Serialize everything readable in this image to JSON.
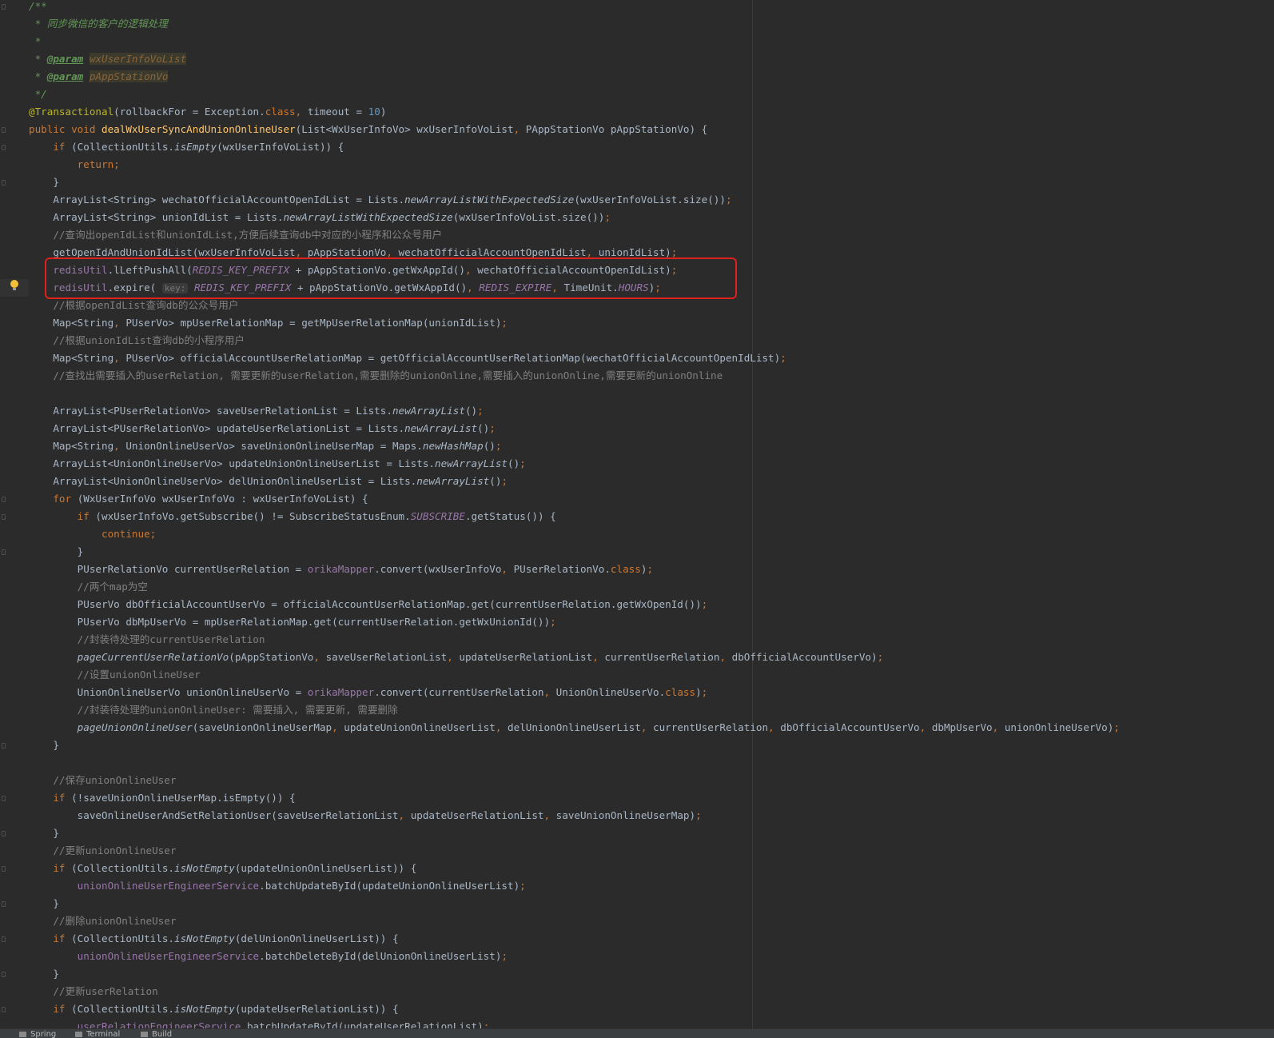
{
  "editor": {
    "lines": [
      [
        {
          "t": "/**",
          "c": "doc"
        }
      ],
      [
        {
          "t": " * 同步微信的客户的逻辑处理",
          "c": "doc"
        }
      ],
      [
        {
          "t": " *",
          "c": "doc"
        }
      ],
      [
        {
          "t": " * ",
          "c": "doc"
        },
        {
          "t": "@param",
          "c": "tag"
        },
        {
          "t": " ",
          "c": "doc"
        },
        {
          "t": "wxUserInfoVoList",
          "c": "docparam"
        }
      ],
      [
        {
          "t": " * ",
          "c": "doc"
        },
        {
          "t": "@param",
          "c": "tag"
        },
        {
          "t": " ",
          "c": "doc"
        },
        {
          "t": "pAppStationVo",
          "c": "docparam"
        }
      ],
      [
        {
          "t": " */",
          "c": "doc"
        }
      ],
      [
        {
          "t": "@Transactional",
          "c": "ann"
        },
        {
          "t": "(rollbackFor = Exception."
        },
        {
          "t": "class",
          "c": "kw"
        },
        {
          "t": ", ",
          "c": "kw"
        },
        {
          "t": "timeout = "
        },
        {
          "t": "10",
          "c": "num"
        },
        {
          "t": ")"
        }
      ],
      [
        {
          "t": "public void ",
          "c": "kw"
        },
        {
          "t": "dealWxUserSyncAndUnionOnlineUser",
          "c": "fn"
        },
        {
          "t": "(List<WxUserInfoVo> wxUserInfoVoList"
        },
        {
          "t": ", ",
          "c": "kw"
        },
        {
          "t": "PAppStationVo pAppStationVo) {"
        }
      ],
      [
        {
          "t": "    "
        },
        {
          "t": "if ",
          "c": "kw"
        },
        {
          "t": "(CollectionUtils."
        },
        {
          "t": "isEmpty",
          "c": "sm"
        },
        {
          "t": "(wxUserInfoVoList)) {"
        }
      ],
      [
        {
          "t": "        "
        },
        {
          "t": "return;",
          "c": "kw"
        }
      ],
      [
        {
          "t": "    }"
        }
      ],
      [
        {
          "t": "    ArrayList<String> wechatOfficialAccountOpenIdList = Lists."
        },
        {
          "t": "newArrayListWithExpectedSize",
          "c": "sm"
        },
        {
          "t": "(wxUserInfoVoList.size())"
        },
        {
          "t": ";",
          "c": "kw"
        }
      ],
      [
        {
          "t": "    ArrayList<String> unionIdList = Lists."
        },
        {
          "t": "newArrayListWithExpectedSize",
          "c": "sm"
        },
        {
          "t": "(wxUserInfoVoList.size())"
        },
        {
          "t": ";",
          "c": "kw"
        }
      ],
      [
        {
          "t": "    "
        },
        {
          "t": "//查询出openIdList和unionIdList,方便后续查询db中对应的小程序和公众号用户",
          "c": "cm"
        }
      ],
      [
        {
          "t": "    getOpenIdAndUnionIdList(wxUserInfoVoList"
        },
        {
          "t": ", ",
          "c": "kw"
        },
        {
          "t": "pAppStationVo"
        },
        {
          "t": ", ",
          "c": "kw"
        },
        {
          "t": "wechatOfficialAccountOpenIdList"
        },
        {
          "t": ", ",
          "c": "kw"
        },
        {
          "t": "unionIdList)"
        },
        {
          "t": ";",
          "c": "kw"
        }
      ],
      [
        {
          "t": "    "
        },
        {
          "t": "redisUtil",
          "c": "field"
        },
        {
          "t": ".lLeftPushAll("
        },
        {
          "t": "REDIS_KEY_PREFIX",
          "c": "static"
        },
        {
          "t": " + pAppStationVo.getWxAppId()"
        },
        {
          "t": ", ",
          "c": "kw"
        },
        {
          "t": "wechatOfficialAccountOpenIdList)"
        },
        {
          "t": ";",
          "c": "kw"
        }
      ],
      [
        {
          "t": "    "
        },
        {
          "t": "redisUtil",
          "c": "field"
        },
        {
          "t": ".expire( "
        },
        {
          "t": "key:",
          "c": "hint"
        },
        {
          "t": " "
        },
        {
          "t": "REDIS_KEY_PREFIX",
          "c": "static"
        },
        {
          "t": " + pAppStationVo.getWxAppId()"
        },
        {
          "t": ", ",
          "c": "kw"
        },
        {
          "t": "REDIS_EXPIRE",
          "c": "static"
        },
        {
          "t": ", ",
          "c": "kw"
        },
        {
          "t": "TimeUnit."
        },
        {
          "t": "HOURS",
          "c": "static"
        },
        {
          "t": ")"
        },
        {
          "t": ";",
          "c": "kw"
        }
      ],
      [
        {
          "t": "    "
        },
        {
          "t": "//根据openIdList查询db的公众号用户",
          "c": "cm"
        }
      ],
      [
        {
          "t": "    Map<String"
        },
        {
          "t": ", ",
          "c": "kw"
        },
        {
          "t": "PUserVo> mpUserRelationMap = getMpUserRelationMap(unionIdList)"
        },
        {
          "t": ";",
          "c": "kw"
        }
      ],
      [
        {
          "t": "    "
        },
        {
          "t": "//根据unionIdList查询db的小程序用户",
          "c": "cm"
        }
      ],
      [
        {
          "t": "    Map<String"
        },
        {
          "t": ", ",
          "c": "kw"
        },
        {
          "t": "PUserVo> officialAccountUserRelationMap = getOfficialAccountUserRelationMap(wechatOfficialAccountOpenIdList)"
        },
        {
          "t": ";",
          "c": "kw"
        }
      ],
      [
        {
          "t": "    "
        },
        {
          "t": "//查找出需要插入的userRelation, 需要更新的userRelation,需要删除的unionOnline,需要插入的unionOnline,需要更新的unionOnline",
          "c": "cm"
        }
      ],
      [],
      [
        {
          "t": "    ArrayList<PUserRelationVo> saveUserRelationList = Lists."
        },
        {
          "t": "newArrayList",
          "c": "sm"
        },
        {
          "t": "()"
        },
        {
          "t": ";",
          "c": "kw"
        }
      ],
      [
        {
          "t": "    ArrayList<PUserRelationVo> updateUserRelationList = Lists."
        },
        {
          "t": "newArrayList",
          "c": "sm"
        },
        {
          "t": "()"
        },
        {
          "t": ";",
          "c": "kw"
        }
      ],
      [
        {
          "t": "    Map<String"
        },
        {
          "t": ", ",
          "c": "kw"
        },
        {
          "t": "UnionOnlineUserVo> saveUnionOnlineUserMap = Maps."
        },
        {
          "t": "newHashMap",
          "c": "sm"
        },
        {
          "t": "()"
        },
        {
          "t": ";",
          "c": "kw"
        }
      ],
      [
        {
          "t": "    ArrayList<UnionOnlineUserVo> updateUnionOnlineUserList = Lists."
        },
        {
          "t": "newArrayList",
          "c": "sm"
        },
        {
          "t": "()"
        },
        {
          "t": ";",
          "c": "kw"
        }
      ],
      [
        {
          "t": "    ArrayList<UnionOnlineUserVo> delUnionOnlineUserList = Lists."
        },
        {
          "t": "newArrayList",
          "c": "sm"
        },
        {
          "t": "()"
        },
        {
          "t": ";",
          "c": "kw"
        }
      ],
      [
        {
          "t": "    "
        },
        {
          "t": "for ",
          "c": "kw"
        },
        {
          "t": "(WxUserInfoVo wxUserInfoVo : wxUserInfoVoList) {"
        }
      ],
      [
        {
          "t": "        "
        },
        {
          "t": "if ",
          "c": "kw"
        },
        {
          "t": "(wxUserInfoVo.getSubscribe() != SubscribeStatusEnum."
        },
        {
          "t": "SUBSCRIBE",
          "c": "static"
        },
        {
          "t": ".getStatus()) {"
        }
      ],
      [
        {
          "t": "            "
        },
        {
          "t": "continue;",
          "c": "kw"
        }
      ],
      [
        {
          "t": "        }"
        }
      ],
      [
        {
          "t": "        PUserRelationVo currentUserRelation = "
        },
        {
          "t": "orikaMapper",
          "c": "field"
        },
        {
          "t": ".convert(wxUserInfoVo"
        },
        {
          "t": ", ",
          "c": "kw"
        },
        {
          "t": "PUserRelationVo."
        },
        {
          "t": "class",
          "c": "kw"
        },
        {
          "t": ")"
        },
        {
          "t": ";",
          "c": "kw"
        }
      ],
      [
        {
          "t": "        "
        },
        {
          "t": "//两个map为空",
          "c": "cm"
        }
      ],
      [
        {
          "t": "        PUserVo dbOfficialAccountUserVo = officialAccountUserRelationMap.get(currentUserRelation.getWxOpenId())"
        },
        {
          "t": ";",
          "c": "kw"
        }
      ],
      [
        {
          "t": "        PUserVo dbMpUserVo = mpUserRelationMap.get(currentUserRelation.getWxUnionId())"
        },
        {
          "t": ";",
          "c": "kw"
        }
      ],
      [
        {
          "t": "        "
        },
        {
          "t": "//封装待处理的currentUserRelation",
          "c": "cm"
        }
      ],
      [
        {
          "t": "        "
        },
        {
          "t": "pageCurrentUserRelationVo",
          "c": "sm"
        },
        {
          "t": "(pAppStationVo"
        },
        {
          "t": ", ",
          "c": "kw"
        },
        {
          "t": "saveUserRelationList"
        },
        {
          "t": ", ",
          "c": "kw"
        },
        {
          "t": "updateUserRelationList"
        },
        {
          "t": ", ",
          "c": "kw"
        },
        {
          "t": "currentUserRelation"
        },
        {
          "t": ", ",
          "c": "kw"
        },
        {
          "t": "dbOfficialAccountUserVo)"
        },
        {
          "t": ";",
          "c": "kw"
        }
      ],
      [
        {
          "t": "        "
        },
        {
          "t": "//设置unionOnlineUser",
          "c": "cm"
        }
      ],
      [
        {
          "t": "        UnionOnlineUserVo unionOnlineUserVo = "
        },
        {
          "t": "orikaMapper",
          "c": "field"
        },
        {
          "t": ".convert(currentUserRelation"
        },
        {
          "t": ", ",
          "c": "kw"
        },
        {
          "t": "UnionOnlineUserVo."
        },
        {
          "t": "class",
          "c": "kw"
        },
        {
          "t": ")"
        },
        {
          "t": ";",
          "c": "kw"
        }
      ],
      [
        {
          "t": "        "
        },
        {
          "t": "//封装待处理的unionOnlineUser: 需要插入, 需要更新, 需要删除",
          "c": "cm"
        }
      ],
      [
        {
          "t": "        "
        },
        {
          "t": "pageUnionOnlineUser",
          "c": "sm"
        },
        {
          "t": "(saveUnionOnlineUserMap"
        },
        {
          "t": ", ",
          "c": "kw"
        },
        {
          "t": "updateUnionOnlineUserList"
        },
        {
          "t": ", ",
          "c": "kw"
        },
        {
          "t": "delUnionOnlineUserList"
        },
        {
          "t": ", ",
          "c": "kw"
        },
        {
          "t": "currentUserRelation"
        },
        {
          "t": ", ",
          "c": "kw"
        },
        {
          "t": "dbOfficialAccountUserVo"
        },
        {
          "t": ", ",
          "c": "kw"
        },
        {
          "t": "dbMpUserVo"
        },
        {
          "t": ", ",
          "c": "kw"
        },
        {
          "t": "unionOnlineUserVo)"
        },
        {
          "t": ";",
          "c": "kw"
        }
      ],
      [
        {
          "t": "    }"
        }
      ],
      [],
      [
        {
          "t": "    "
        },
        {
          "t": "//保存unionOnlineUser",
          "c": "cm"
        }
      ],
      [
        {
          "t": "    "
        },
        {
          "t": "if ",
          "c": "kw"
        },
        {
          "t": "(!saveUnionOnlineUserMap.isEmpty()) {"
        }
      ],
      [
        {
          "t": "        saveOnlineUserAndSetRelationUser(saveUserRelationList"
        },
        {
          "t": ", ",
          "c": "kw"
        },
        {
          "t": "updateUserRelationList"
        },
        {
          "t": ", ",
          "c": "kw"
        },
        {
          "t": "saveUnionOnlineUserMap)"
        },
        {
          "t": ";",
          "c": "kw"
        }
      ],
      [
        {
          "t": "    }"
        }
      ],
      [
        {
          "t": "    "
        },
        {
          "t": "//更新unionOnlineUser",
          "c": "cm"
        }
      ],
      [
        {
          "t": "    "
        },
        {
          "t": "if ",
          "c": "kw"
        },
        {
          "t": "(CollectionUtils."
        },
        {
          "t": "isNotEmpty",
          "c": "sm"
        },
        {
          "t": "(updateUnionOnlineUserList)) {"
        }
      ],
      [
        {
          "t": "        "
        },
        {
          "t": "unionOnlineUserEngineerService",
          "c": "field"
        },
        {
          "t": ".batchUpdateById(updateUnionOnlineUserList)"
        },
        {
          "t": ";",
          "c": "kw"
        }
      ],
      [
        {
          "t": "    }"
        }
      ],
      [
        {
          "t": "    "
        },
        {
          "t": "//删除unionOnlineUser",
          "c": "cm"
        }
      ],
      [
        {
          "t": "    "
        },
        {
          "t": "if ",
          "c": "kw"
        },
        {
          "t": "(CollectionUtils."
        },
        {
          "t": "isNotEmpty",
          "c": "sm"
        },
        {
          "t": "(delUnionOnlineUserList)) {"
        }
      ],
      [
        {
          "t": "        "
        },
        {
          "t": "unionOnlineUserEngineerService",
          "c": "field"
        },
        {
          "t": ".batchDeleteById(delUnionOnlineUserList)"
        },
        {
          "t": ";",
          "c": "kw"
        }
      ],
      [
        {
          "t": "    }"
        }
      ],
      [
        {
          "t": "    "
        },
        {
          "t": "//更新userRelation",
          "c": "cm"
        }
      ],
      [
        {
          "t": "    "
        },
        {
          "t": "if ",
          "c": "kw"
        },
        {
          "t": "(CollectionUtils."
        },
        {
          "t": "isNotEmpty",
          "c": "sm"
        },
        {
          "t": "(updateUserRelationList)) {"
        }
      ],
      [
        {
          "t": "        "
        },
        {
          "t": "userRelationEngineerService",
          "c": "field"
        },
        {
          "t": ".batchUpdateById(updateUserRelationList)"
        },
        {
          "t": ";",
          "c": "kw"
        }
      ]
    ],
    "caret_line": 16,
    "highlight_lines": [
      15,
      16
    ],
    "intention_bulb_icon": "lightbulb-icon"
  },
  "toolwindows": [
    {
      "label": "Spring",
      "icon": "spring-icon"
    },
    {
      "label": "Terminal",
      "icon": "terminal-icon"
    },
    {
      "label": "Build",
      "icon": "build-icon"
    }
  ],
  "colors": {
    "background": "#2b2b2b",
    "keyword": "#cc7832",
    "comment": "#808080",
    "doc_comment": "#629755",
    "annotation": "#bbb529",
    "method_declaration": "#ffc66d",
    "number": "#6897bb",
    "field": "#9876aa",
    "highlight_box": "#e0201b"
  }
}
